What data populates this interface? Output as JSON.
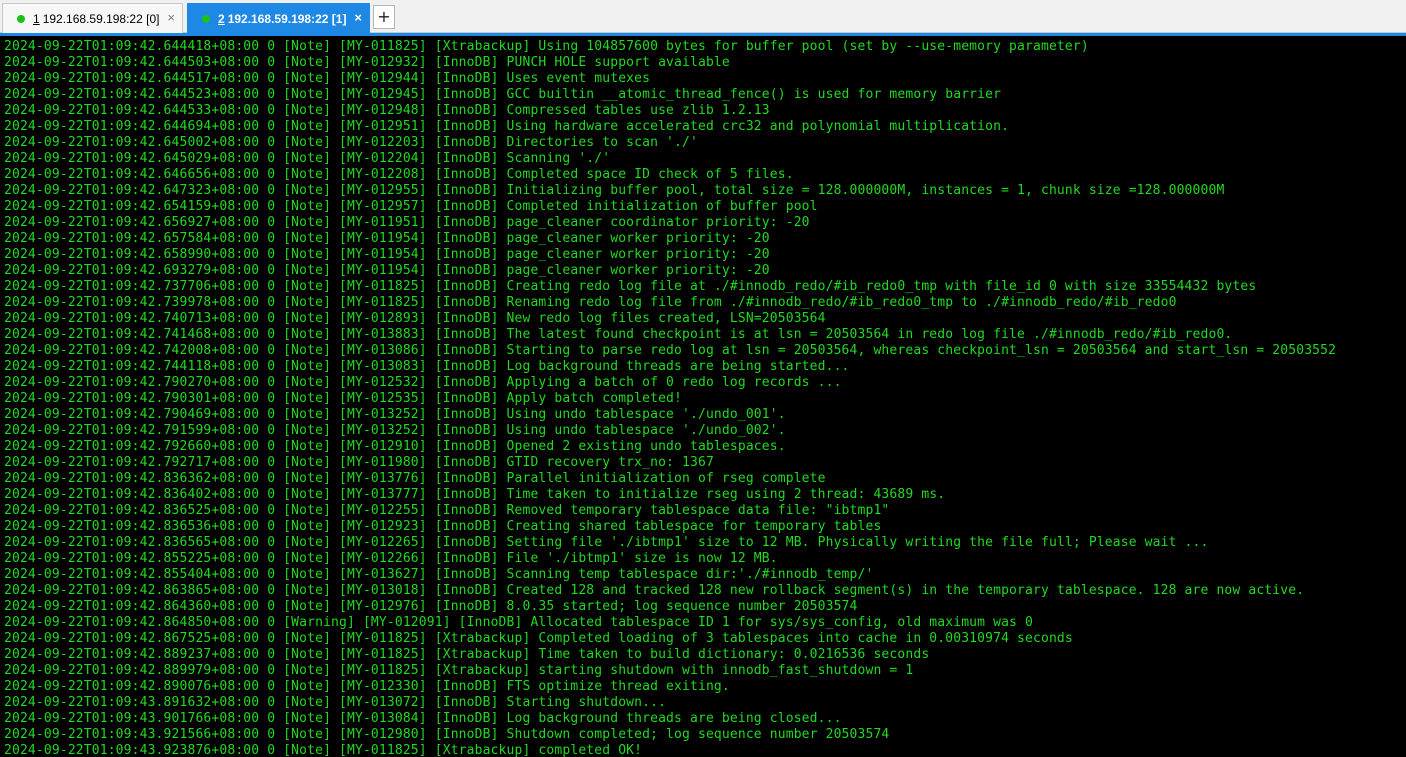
{
  "tabs": [
    {
      "number": "1",
      "title": " 192.168.59.198:22 [0]",
      "active": false,
      "status_color": "#19c219",
      "close": "×"
    },
    {
      "number": "2",
      "title": " 192.168.59.198:22 [1]",
      "active": true,
      "status_color": "#19c219",
      "close": "×"
    }
  ],
  "new_tab_label": "+",
  "colors": {
    "accent": "#1e88e5",
    "terminal_bg": "#000000",
    "terminal_text": "#23d823"
  },
  "log_lines": [
    "2024-09-22T01:09:42.644418+08:00 0 [Note] [MY-011825] [Xtrabackup] Using 104857600 bytes for buffer pool (set by --use-memory parameter)",
    "2024-09-22T01:09:42.644503+08:00 0 [Note] [MY-012932] [InnoDB] PUNCH HOLE support available",
    "2024-09-22T01:09:42.644517+08:00 0 [Note] [MY-012944] [InnoDB] Uses event mutexes",
    "2024-09-22T01:09:42.644523+08:00 0 [Note] [MY-012945] [InnoDB] GCC builtin __atomic_thread_fence() is used for memory barrier",
    "2024-09-22T01:09:42.644533+08:00 0 [Note] [MY-012948] [InnoDB] Compressed tables use zlib 1.2.13",
    "2024-09-22T01:09:42.644694+08:00 0 [Note] [MY-012951] [InnoDB] Using hardware accelerated crc32 and polynomial multiplication.",
    "2024-09-22T01:09:42.645002+08:00 0 [Note] [MY-012203] [InnoDB] Directories to scan './'",
    "2024-09-22T01:09:42.645029+08:00 0 [Note] [MY-012204] [InnoDB] Scanning './'",
    "2024-09-22T01:09:42.646656+08:00 0 [Note] [MY-012208] [InnoDB] Completed space ID check of 5 files.",
    "2024-09-22T01:09:42.647323+08:00 0 [Note] [MY-012955] [InnoDB] Initializing buffer pool, total size = 128.000000M, instances = 1, chunk size =128.000000M",
    "2024-09-22T01:09:42.654159+08:00 0 [Note] [MY-012957] [InnoDB] Completed initialization of buffer pool",
    "2024-09-22T01:09:42.656927+08:00 0 [Note] [MY-011951] [InnoDB] page_cleaner coordinator priority: -20",
    "2024-09-22T01:09:42.657584+08:00 0 [Note] [MY-011954] [InnoDB] page_cleaner worker priority: -20",
    "2024-09-22T01:09:42.658990+08:00 0 [Note] [MY-011954] [InnoDB] page_cleaner worker priority: -20",
    "2024-09-22T01:09:42.693279+08:00 0 [Note] [MY-011954] [InnoDB] page_cleaner worker priority: -20",
    "2024-09-22T01:09:42.737706+08:00 0 [Note] [MY-011825] [InnoDB] Creating redo log file at ./#innodb_redo/#ib_redo0_tmp with file_id 0 with size 33554432 bytes",
    "2024-09-22T01:09:42.739978+08:00 0 [Note] [MY-011825] [InnoDB] Renaming redo log file from ./#innodb_redo/#ib_redo0_tmp to ./#innodb_redo/#ib_redo0",
    "2024-09-22T01:09:42.740713+08:00 0 [Note] [MY-012893] [InnoDB] New redo log files created, LSN=20503564",
    "2024-09-22T01:09:42.741468+08:00 0 [Note] [MY-013883] [InnoDB] The latest found checkpoint is at lsn = 20503564 in redo log file ./#innodb_redo/#ib_redo0.",
    "2024-09-22T01:09:42.742008+08:00 0 [Note] [MY-013086] [InnoDB] Starting to parse redo log at lsn = 20503564, whereas checkpoint_lsn = 20503564 and start_lsn = 20503552",
    "2024-09-22T01:09:42.744118+08:00 0 [Note] [MY-013083] [InnoDB] Log background threads are being started...",
    "2024-09-22T01:09:42.790270+08:00 0 [Note] [MY-012532] [InnoDB] Applying a batch of 0 redo log records ...",
    "2024-09-22T01:09:42.790301+08:00 0 [Note] [MY-012535] [InnoDB] Apply batch completed!",
    "2024-09-22T01:09:42.790469+08:00 0 [Note] [MY-013252] [InnoDB] Using undo tablespace './undo_001'.",
    "2024-09-22T01:09:42.791599+08:00 0 [Note] [MY-013252] [InnoDB] Using undo tablespace './undo_002'.",
    "2024-09-22T01:09:42.792660+08:00 0 [Note] [MY-012910] [InnoDB] Opened 2 existing undo tablespaces.",
    "2024-09-22T01:09:42.792717+08:00 0 [Note] [MY-011980] [InnoDB] GTID recovery trx_no: 1367",
    "2024-09-22T01:09:42.836362+08:00 0 [Note] [MY-013776] [InnoDB] Parallel initialization of rseg complete",
    "2024-09-22T01:09:42.836402+08:00 0 [Note] [MY-013777] [InnoDB] Time taken to initialize rseg using 2 thread: 43689 ms.",
    "2024-09-22T01:09:42.836525+08:00 0 [Note] [MY-012255] [InnoDB] Removed temporary tablespace data file: \"ibtmp1\"",
    "2024-09-22T01:09:42.836536+08:00 0 [Note] [MY-012923] [InnoDB] Creating shared tablespace for temporary tables",
    "2024-09-22T01:09:42.836565+08:00 0 [Note] [MY-012265] [InnoDB] Setting file './ibtmp1' size to 12 MB. Physically writing the file full; Please wait ...",
    "2024-09-22T01:09:42.855225+08:00 0 [Note] [MY-012266] [InnoDB] File './ibtmp1' size is now 12 MB.",
    "2024-09-22T01:09:42.855404+08:00 0 [Note] [MY-013627] [InnoDB] Scanning temp tablespace dir:'./#innodb_temp/'",
    "2024-09-22T01:09:42.863865+08:00 0 [Note] [MY-013018] [InnoDB] Created 128 and tracked 128 new rollback segment(s) in the temporary tablespace. 128 are now active.",
    "2024-09-22T01:09:42.864360+08:00 0 [Note] [MY-012976] [InnoDB] 8.0.35 started; log sequence number 20503574",
    "2024-09-22T01:09:42.864850+08:00 0 [Warning] [MY-012091] [InnoDB] Allocated tablespace ID 1 for sys/sys_config, old maximum was 0",
    "2024-09-22T01:09:42.867525+08:00 0 [Note] [MY-011825] [Xtrabackup] Completed loading of 3 tablespaces into cache in 0.00310974 seconds",
    "2024-09-22T01:09:42.889237+08:00 0 [Note] [MY-011825] [Xtrabackup] Time taken to build dictionary: 0.0216536 seconds",
    "2024-09-22T01:09:42.889979+08:00 0 [Note] [MY-011825] [Xtrabackup] starting shutdown with innodb_fast_shutdown = 1",
    "2024-09-22T01:09:42.890076+08:00 0 [Note] [MY-012330] [InnoDB] FTS optimize thread exiting.",
    "2024-09-22T01:09:43.891632+08:00 0 [Note] [MY-013072] [InnoDB] Starting shutdown...",
    "2024-09-22T01:09:43.901766+08:00 0 [Note] [MY-013084] [InnoDB] Log background threads are being closed...",
    "2024-09-22T01:09:43.921566+08:00 0 [Note] [MY-012980] [InnoDB] Shutdown completed; log sequence number 20503574",
    "2024-09-22T01:09:43.923876+08:00 0 [Note] [MY-011825] [Xtrabackup] completed OK!"
  ]
}
